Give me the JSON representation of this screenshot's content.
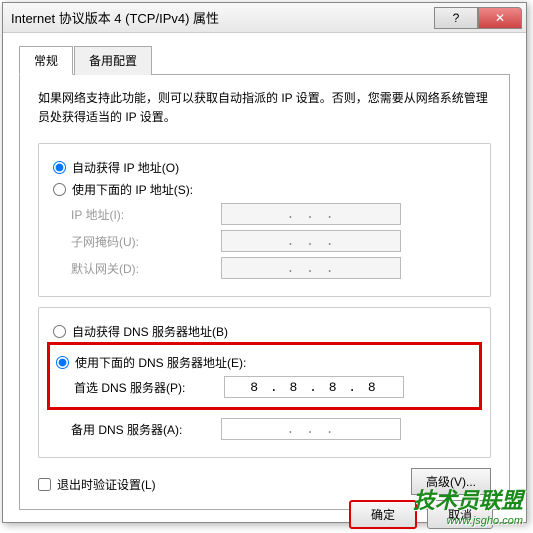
{
  "title": "Internet 协议版本 4 (TCP/IPv4) 属性",
  "tabs": {
    "general": "常规",
    "alternate": "备用配置"
  },
  "description": "如果网络支持此功能，则可以获取自动指派的 IP 设置。否则，您需要从网络系统管理员处获得适当的 IP 设置。",
  "ip": {
    "auto": "自动获得 IP 地址(O)",
    "manual": "使用下面的 IP 地址(S):",
    "address_label": "IP 地址(I):",
    "mask_label": "子网掩码(U):",
    "gateway_label": "默认网关(D):"
  },
  "dns": {
    "auto": "自动获得 DNS 服务器地址(B)",
    "manual": "使用下面的 DNS 服务器地址(E):",
    "preferred_label": "首选 DNS 服务器(P):",
    "preferred_value": "8 . 8 . 8 . 8",
    "alternate_label": "备用 DNS 服务器(A):"
  },
  "validate": "退出时验证设置(L)",
  "advanced": "高级(V)...",
  "buttons": {
    "ok": "确定",
    "cancel": "取消"
  },
  "watermark": {
    "text": "技术员联盟",
    "url": "www.jsgho.com"
  },
  "dots": ".   .   ."
}
